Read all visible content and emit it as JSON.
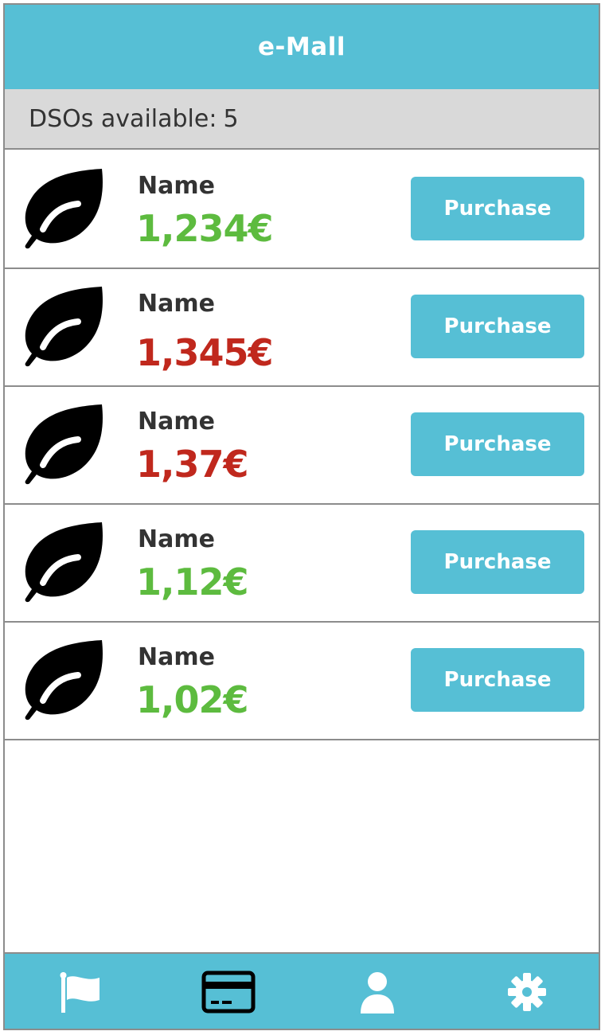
{
  "header": {
    "title": "e-Mall"
  },
  "subheader": {
    "label": "DSOs available:",
    "count": "5"
  },
  "items": [
    {
      "name": "Name",
      "price": "1,234€",
      "price_color": "#5dbb3f",
      "icon": "leaf-icon",
      "action": "Purchase"
    },
    {
      "name": "Name",
      "price": "1,345€",
      "price_color": "#c0281d",
      "icon": "leaf-icon",
      "action": "Purchase"
    },
    {
      "name": "Name",
      "price": "1,37€",
      "price_color": "#c0281d",
      "icon": "leaf-icon",
      "action": "Purchase"
    },
    {
      "name": "Name",
      "price": "1,12€",
      "price_color": "#5dbb3f",
      "icon": "leaf-icon",
      "action": "Purchase"
    },
    {
      "name": "Name",
      "price": "1,02€",
      "price_color": "#5dbb3f",
      "icon": "leaf-icon",
      "action": "Purchase"
    }
  ],
  "tabbar": {
    "tabs": [
      {
        "icon": "flag-icon",
        "active": false
      },
      {
        "icon": "credit-card-icon",
        "active": true
      },
      {
        "icon": "user-icon",
        "active": false
      },
      {
        "icon": "gear-icon",
        "active": false
      }
    ]
  },
  "colors": {
    "accent": "#56bfd5",
    "positive": "#5dbb3f",
    "negative": "#c0281d"
  }
}
